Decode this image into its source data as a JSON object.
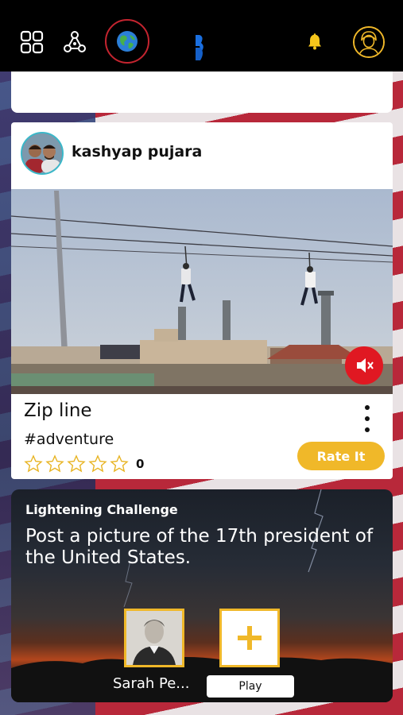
{
  "topbar": {
    "icons": [
      "grid-icon",
      "network-icon",
      "globe-icon",
      "brand-logo",
      "bell-icon",
      "profile-avatar"
    ],
    "accent": "#f0b829",
    "active_border": "#c4242f"
  },
  "post": {
    "username": "kashyap pujara",
    "title": "Zip line",
    "tag": "#adventure",
    "rating_count": "0",
    "star_count": 5,
    "rate_label": "Rate It",
    "more_icon": "vertical-dots-icon",
    "mute_icon": "speaker-mute-icon"
  },
  "challenge": {
    "label": "Lightening Challenge",
    "text": "Post a picture of the 17th president of the United States.",
    "entry_name": "Sarah Pe...",
    "add_icon": "plus-icon",
    "play_label": "Play"
  },
  "colors": {
    "rate_button": "#f0b829",
    "mute_button": "#e01822"
  }
}
